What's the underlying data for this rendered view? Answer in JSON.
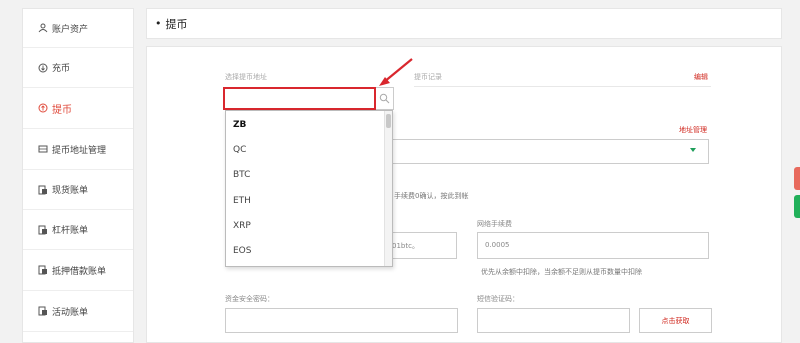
{
  "sidebar": {
    "items": [
      {
        "label": "账户资产",
        "icon": "person-icon"
      },
      {
        "label": "充币",
        "icon": "deposit-icon"
      },
      {
        "label": "提币",
        "icon": "withdraw-icon",
        "active": true
      },
      {
        "label": "提币地址管理",
        "icon": "address-book-icon"
      },
      {
        "label": "现货账单",
        "icon": "bill-icon"
      },
      {
        "label": "杠杆账单",
        "icon": "bill-icon"
      },
      {
        "label": "抵押借款账单",
        "icon": "bill-icon"
      },
      {
        "label": "活动账单",
        "icon": "bill-icon"
      }
    ]
  },
  "header": {
    "bullet": "•",
    "title": "提币"
  },
  "form": {
    "coin_label": "选择提币地址",
    "history_label": "提币记录",
    "edit_link": "编辑",
    "address_manage_link": "地址管理",
    "fee_hint": "手续费0确认，按此到帐",
    "amount_value": "01btc。",
    "network_fee_label": "网络手续费",
    "network_fee_value": "0.0005",
    "fee_note": "优先从余额中扣除，当余额不足则从提币数量中扣除",
    "security_pwd_label": "资金安全密码：",
    "sms_code_label": "短信验证码：",
    "get_code_button": "点击获取"
  },
  "dropdown": {
    "search_value": "",
    "options": [
      "ZB",
      "QC",
      "BTC",
      "ETH",
      "XRP",
      "EOS"
    ],
    "selected_bold": "ZB"
  },
  "colors": {
    "accent": "#d0271e",
    "highlight_border": "#d9272e",
    "arrow": "#d9272e",
    "edge_tab_red": "#e86a5d",
    "edge_tab_green": "#21b05a"
  }
}
